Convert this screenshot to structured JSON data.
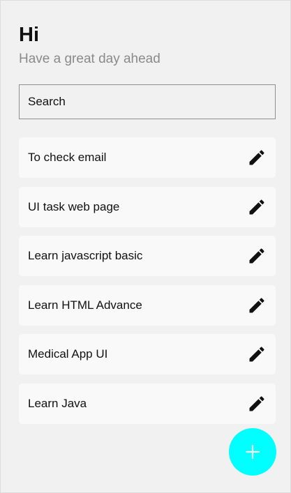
{
  "header": {
    "title": "Hi",
    "subtitle": "Have a great day ahead"
  },
  "search": {
    "placeholder": "Search"
  },
  "tasks": [
    {
      "label": "To check email",
      "icon": "pencil-icon"
    },
    {
      "label": "UI task web page",
      "icon": "pencil-icon"
    },
    {
      "label": "Learn javascript basic",
      "icon": "pencil-icon"
    },
    {
      "label": "Learn HTML Advance",
      "icon": "pencil-icon"
    },
    {
      "label": "Medical App UI",
      "icon": "pencil-icon"
    },
    {
      "label": "Learn Java",
      "icon": "pencil-icon"
    }
  ],
  "fab": {
    "icon": "plus-icon"
  },
  "colors": {
    "background": "#f1f1f1",
    "card": "#f9f9f9",
    "fab": "#00ffff",
    "text": "#111111",
    "subtitle": "#8a8a8a"
  }
}
